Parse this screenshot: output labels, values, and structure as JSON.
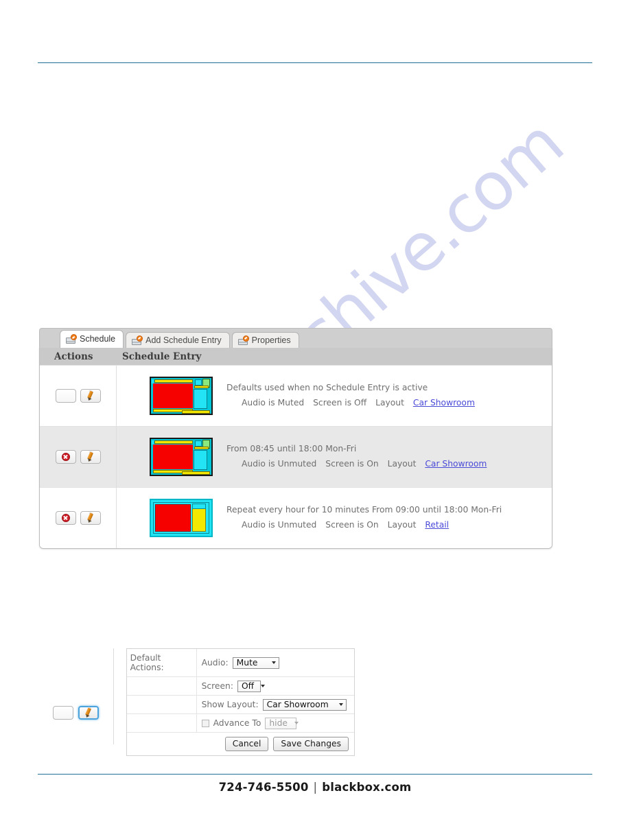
{
  "footer": {
    "phone": "724-746-5500",
    "separator": "|",
    "site": "blackbox.com"
  },
  "watermark": {
    "text": "manualshive.com"
  },
  "app": {
    "tabs": [
      {
        "label": "Schedule",
        "icon": "schedule-card-icon",
        "active": true
      },
      {
        "label": "Add Schedule Entry",
        "icon": "schedule-card-icon",
        "active": false
      },
      {
        "label": "Properties",
        "icon": "schedule-card-icon",
        "active": false
      }
    ],
    "table": {
      "headers": {
        "actions": "Actions",
        "entry": "Schedule Entry"
      },
      "rows": [
        {
          "thumbnail": "car-showroom-layout-thumbnail",
          "delete_enabled": false,
          "line1": "Defaults used when no Schedule Entry is active",
          "audio": "Audio is Muted",
          "screen": "Screen is Off",
          "layout_label": "Layout",
          "layout_link": "Car Showroom",
          "striped": false
        },
        {
          "thumbnail": "car-showroom-layout-thumbnail",
          "delete_enabled": true,
          "line1": "From 08:45 until 18:00 Mon-Fri",
          "audio": "Audio is Unmuted",
          "screen": "Screen is On",
          "layout_label": "Layout",
          "layout_link": "Car Showroom",
          "striped": true
        },
        {
          "thumbnail": "retail-layout-thumbnail",
          "delete_enabled": true,
          "line1": "Repeat every hour for 10 minutes From 09:00 until 18:00 Mon-Fri",
          "audio": "Audio is Unmuted",
          "screen": "Screen is On",
          "layout_label": "Layout",
          "layout_link": "Retail",
          "striped": false
        }
      ]
    },
    "edit_form": {
      "title": "Default Actions:",
      "audio": {
        "label": "Audio:",
        "value": "Mute"
      },
      "screen": {
        "label": "Screen:",
        "value": "Off"
      },
      "show_layout": {
        "label": "Show Layout:",
        "value": "Car Showroom"
      },
      "advance_to": {
        "label": "Advance To",
        "value": "hide",
        "checked": false
      },
      "cancel_label": "Cancel",
      "save_label": "Save Changes"
    }
  },
  "colors": {
    "rule": "#1f6f96",
    "link": "#4a4ad8",
    "accent_orange": "#f07f1a",
    "delete_red": "#d0202a",
    "header_gray": "#c9c9c9",
    "stripe_gray": "#e8e8e8",
    "watermark": "#b9bde8"
  }
}
